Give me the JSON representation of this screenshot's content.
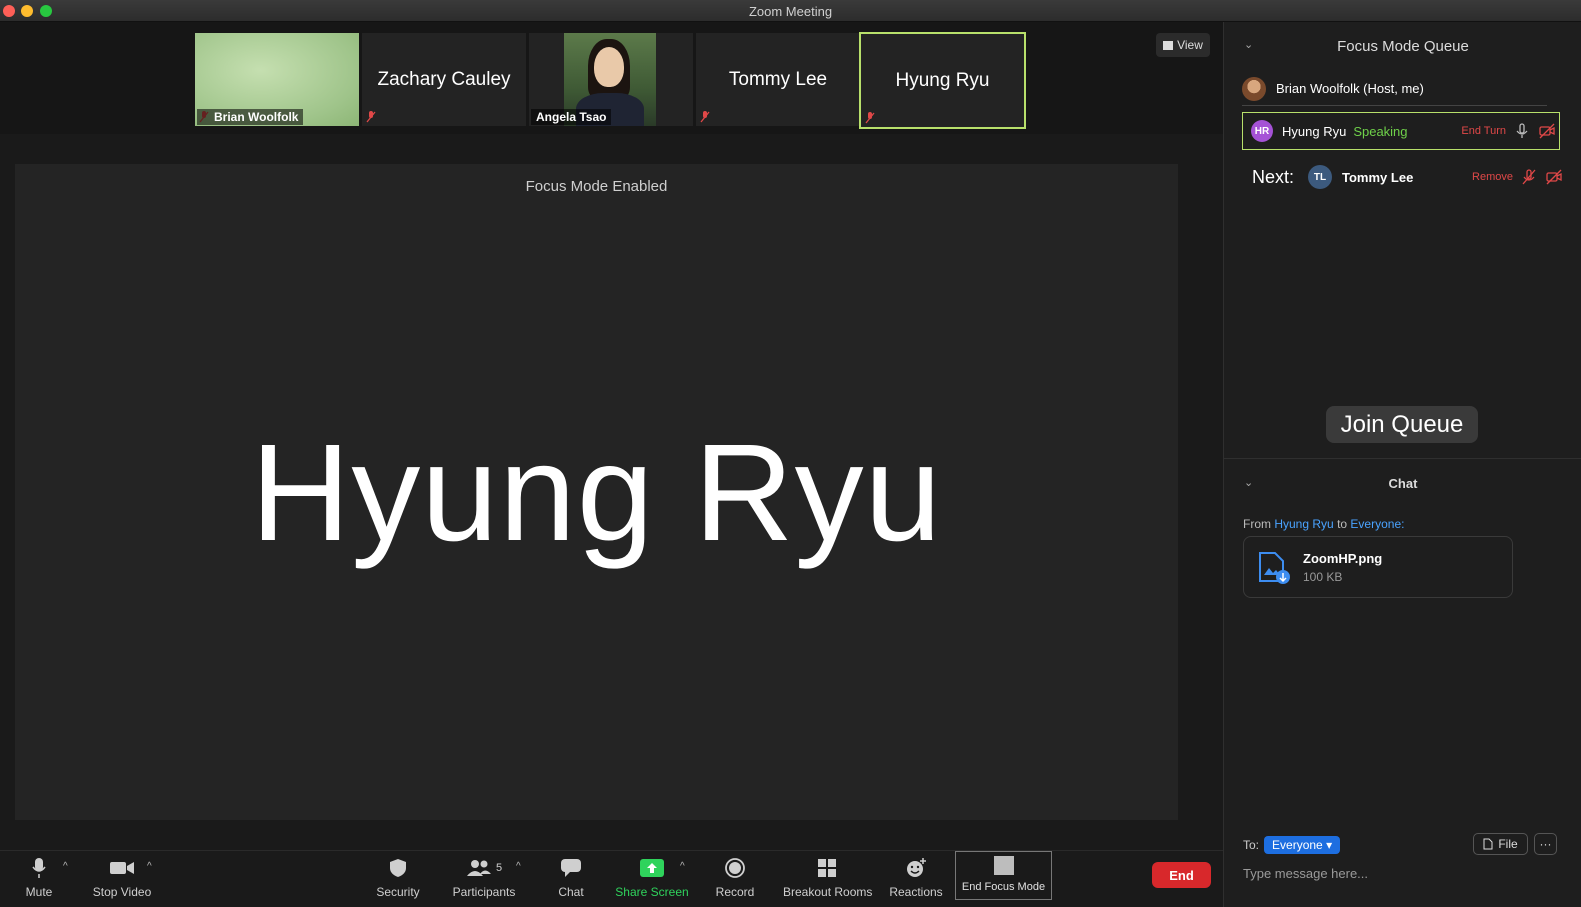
{
  "window": {
    "title": "Zoom Meeting"
  },
  "gallery": {
    "tiles": [
      {
        "label": "Brian Woolfolk",
        "type": "video"
      },
      {
        "name": "Zachary Cauley",
        "type": "name"
      },
      {
        "label": "Angela Tsao",
        "type": "video"
      },
      {
        "name": "Tommy Lee",
        "type": "name"
      },
      {
        "name": "Hyung Ryu",
        "type": "name",
        "active": true
      }
    ],
    "view_label": "View"
  },
  "main": {
    "focus_label": "Focus Mode Enabled",
    "speaker_name": "Hyung Ryu"
  },
  "toolbar": {
    "mute": "Mute",
    "stop_video": "Stop Video",
    "security": "Security",
    "participants": "Participants",
    "participants_count": "5",
    "chat": "Chat",
    "share_screen": "Share Screen",
    "record": "Record",
    "breakout_rooms": "Breakout Rooms",
    "reactions": "Reactions",
    "end_focus_mode": "End Focus Mode",
    "end": "End"
  },
  "queue": {
    "title": "Focus Mode Queue",
    "host": "Brian Woolfolk (Host, me)",
    "speaking": {
      "initials": "HR",
      "name": "Hyung Ryu",
      "status": "Speaking",
      "action": "End Turn"
    },
    "next": {
      "label": "Next:",
      "initials": "TL",
      "name": "Tommy Lee",
      "action": "Remove"
    },
    "join_label": "Join Queue"
  },
  "chat": {
    "title": "Chat",
    "from_prefix": "From",
    "from_name": "Hyung Ryu",
    "to_word": "to",
    "to_name": "Everyone:",
    "file_name": "ZoomHP.png",
    "file_size": "100 KB",
    "to_label": "To:",
    "recipient": "Everyone",
    "file_button": "File",
    "more_button": "···",
    "placeholder": "Type message here..."
  },
  "colors": {
    "accent_green": "#b8e06b",
    "speaking_green": "#6fd14a",
    "end_red": "#d8282b",
    "link_blue": "#4aa3ff"
  }
}
